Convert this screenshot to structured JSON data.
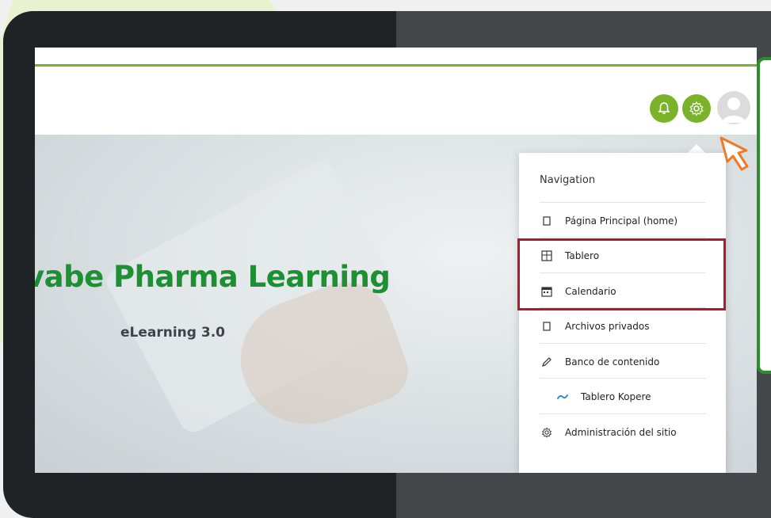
{
  "hero": {
    "title": "vabe Pharma Learning",
    "subtitle": "eLearning 3.0"
  },
  "header": {
    "icons": [
      "notifications-bell-icon",
      "settings-gear-icon",
      "user-avatar"
    ]
  },
  "menu": {
    "heading": "Navigation",
    "items": [
      {
        "label": "Página Principal (home)",
        "icon": "page-icon"
      },
      {
        "label": "Tablero",
        "icon": "dashboard-icon"
      },
      {
        "label": "Calendario",
        "icon": "calendar-icon"
      },
      {
        "label": "Archivos privados",
        "icon": "page-icon"
      },
      {
        "label": "Banco de contenido",
        "icon": "pencil-icon"
      },
      {
        "label": "Tablero Kopere",
        "icon": "kopere-icon"
      },
      {
        "label": "Administración del sitio",
        "icon": "gear-icon"
      }
    ]
  },
  "colors": {
    "brand_green": "#7ab32a",
    "title_green": "#1e8f33",
    "highlight_red": "#b1182b",
    "cursor_orange": "#f07a24"
  }
}
